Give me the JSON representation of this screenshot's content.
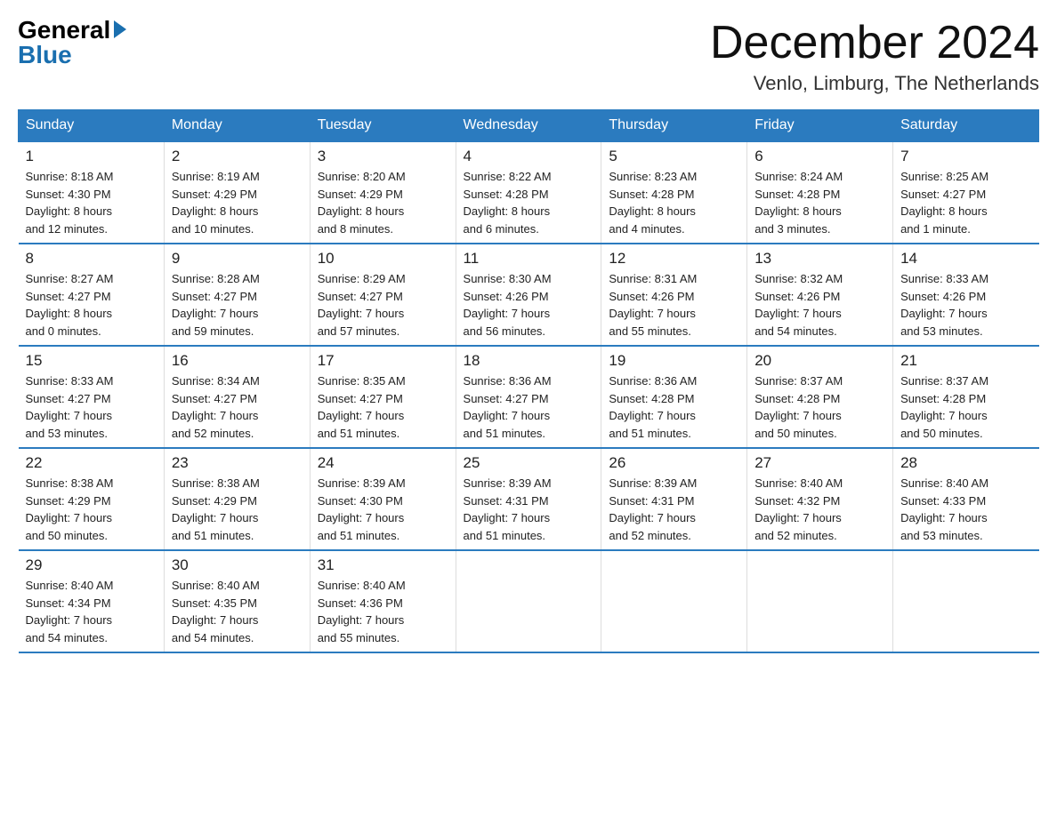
{
  "header": {
    "logo_general": "General",
    "logo_blue": "Blue",
    "month_title": "December 2024",
    "location": "Venlo, Limburg, The Netherlands"
  },
  "weekdays": [
    "Sunday",
    "Monday",
    "Tuesday",
    "Wednesday",
    "Thursday",
    "Friday",
    "Saturday"
  ],
  "weeks": [
    [
      {
        "day": "1",
        "info": "Sunrise: 8:18 AM\nSunset: 4:30 PM\nDaylight: 8 hours\nand 12 minutes."
      },
      {
        "day": "2",
        "info": "Sunrise: 8:19 AM\nSunset: 4:29 PM\nDaylight: 8 hours\nand 10 minutes."
      },
      {
        "day": "3",
        "info": "Sunrise: 8:20 AM\nSunset: 4:29 PM\nDaylight: 8 hours\nand 8 minutes."
      },
      {
        "day": "4",
        "info": "Sunrise: 8:22 AM\nSunset: 4:28 PM\nDaylight: 8 hours\nand 6 minutes."
      },
      {
        "day": "5",
        "info": "Sunrise: 8:23 AM\nSunset: 4:28 PM\nDaylight: 8 hours\nand 4 minutes."
      },
      {
        "day": "6",
        "info": "Sunrise: 8:24 AM\nSunset: 4:28 PM\nDaylight: 8 hours\nand 3 minutes."
      },
      {
        "day": "7",
        "info": "Sunrise: 8:25 AM\nSunset: 4:27 PM\nDaylight: 8 hours\nand 1 minute."
      }
    ],
    [
      {
        "day": "8",
        "info": "Sunrise: 8:27 AM\nSunset: 4:27 PM\nDaylight: 8 hours\nand 0 minutes."
      },
      {
        "day": "9",
        "info": "Sunrise: 8:28 AM\nSunset: 4:27 PM\nDaylight: 7 hours\nand 59 minutes."
      },
      {
        "day": "10",
        "info": "Sunrise: 8:29 AM\nSunset: 4:27 PM\nDaylight: 7 hours\nand 57 minutes."
      },
      {
        "day": "11",
        "info": "Sunrise: 8:30 AM\nSunset: 4:26 PM\nDaylight: 7 hours\nand 56 minutes."
      },
      {
        "day": "12",
        "info": "Sunrise: 8:31 AM\nSunset: 4:26 PM\nDaylight: 7 hours\nand 55 minutes."
      },
      {
        "day": "13",
        "info": "Sunrise: 8:32 AM\nSunset: 4:26 PM\nDaylight: 7 hours\nand 54 minutes."
      },
      {
        "day": "14",
        "info": "Sunrise: 8:33 AM\nSunset: 4:26 PM\nDaylight: 7 hours\nand 53 minutes."
      }
    ],
    [
      {
        "day": "15",
        "info": "Sunrise: 8:33 AM\nSunset: 4:27 PM\nDaylight: 7 hours\nand 53 minutes."
      },
      {
        "day": "16",
        "info": "Sunrise: 8:34 AM\nSunset: 4:27 PM\nDaylight: 7 hours\nand 52 minutes."
      },
      {
        "day": "17",
        "info": "Sunrise: 8:35 AM\nSunset: 4:27 PM\nDaylight: 7 hours\nand 51 minutes."
      },
      {
        "day": "18",
        "info": "Sunrise: 8:36 AM\nSunset: 4:27 PM\nDaylight: 7 hours\nand 51 minutes."
      },
      {
        "day": "19",
        "info": "Sunrise: 8:36 AM\nSunset: 4:28 PM\nDaylight: 7 hours\nand 51 minutes."
      },
      {
        "day": "20",
        "info": "Sunrise: 8:37 AM\nSunset: 4:28 PM\nDaylight: 7 hours\nand 50 minutes."
      },
      {
        "day": "21",
        "info": "Sunrise: 8:37 AM\nSunset: 4:28 PM\nDaylight: 7 hours\nand 50 minutes."
      }
    ],
    [
      {
        "day": "22",
        "info": "Sunrise: 8:38 AM\nSunset: 4:29 PM\nDaylight: 7 hours\nand 50 minutes."
      },
      {
        "day": "23",
        "info": "Sunrise: 8:38 AM\nSunset: 4:29 PM\nDaylight: 7 hours\nand 51 minutes."
      },
      {
        "day": "24",
        "info": "Sunrise: 8:39 AM\nSunset: 4:30 PM\nDaylight: 7 hours\nand 51 minutes."
      },
      {
        "day": "25",
        "info": "Sunrise: 8:39 AM\nSunset: 4:31 PM\nDaylight: 7 hours\nand 51 minutes."
      },
      {
        "day": "26",
        "info": "Sunrise: 8:39 AM\nSunset: 4:31 PM\nDaylight: 7 hours\nand 52 minutes."
      },
      {
        "day": "27",
        "info": "Sunrise: 8:40 AM\nSunset: 4:32 PM\nDaylight: 7 hours\nand 52 minutes."
      },
      {
        "day": "28",
        "info": "Sunrise: 8:40 AM\nSunset: 4:33 PM\nDaylight: 7 hours\nand 53 minutes."
      }
    ],
    [
      {
        "day": "29",
        "info": "Sunrise: 8:40 AM\nSunset: 4:34 PM\nDaylight: 7 hours\nand 54 minutes."
      },
      {
        "day": "30",
        "info": "Sunrise: 8:40 AM\nSunset: 4:35 PM\nDaylight: 7 hours\nand 54 minutes."
      },
      {
        "day": "31",
        "info": "Sunrise: 8:40 AM\nSunset: 4:36 PM\nDaylight: 7 hours\nand 55 minutes."
      },
      {
        "day": "",
        "info": ""
      },
      {
        "day": "",
        "info": ""
      },
      {
        "day": "",
        "info": ""
      },
      {
        "day": "",
        "info": ""
      }
    ]
  ]
}
